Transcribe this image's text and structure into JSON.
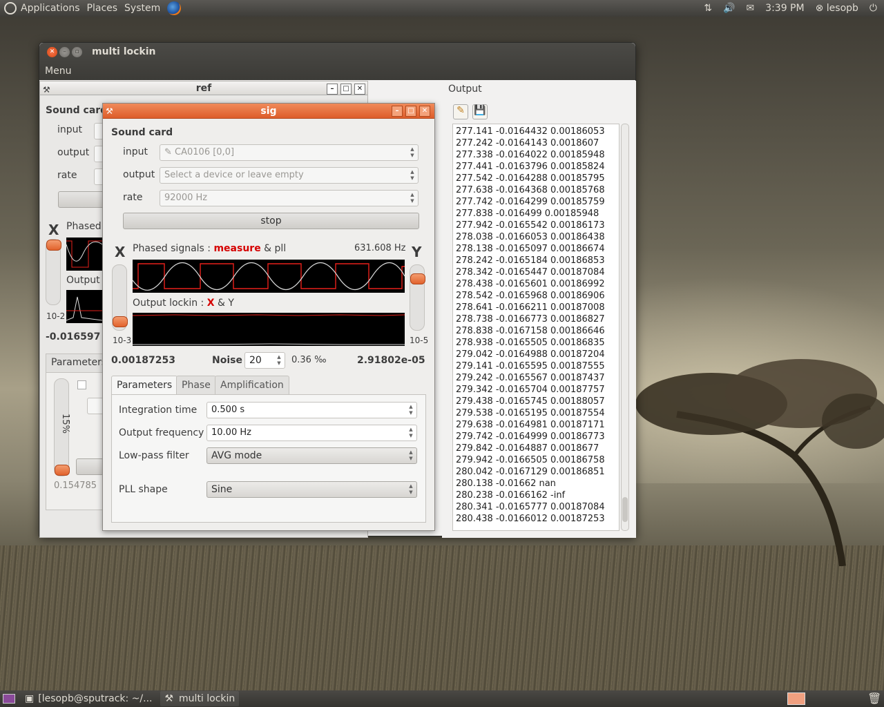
{
  "top_panel": {
    "menus": [
      "Applications",
      "Places",
      "System"
    ],
    "clock": "3:39 PM",
    "user": "lesopb"
  },
  "window": {
    "title": "multi lockin",
    "menu_label": "Menu"
  },
  "ref": {
    "title": "ref",
    "sound_card_label": "Sound card",
    "input_label": "input",
    "output_label": "output",
    "rate_label": "rate",
    "phased_label": "Phased",
    "output_label2": "Output",
    "x_label": "X",
    "scale_exp": "10-2",
    "value": "-0.016597",
    "params_tab": "Parameters",
    "slider_pct": "15%",
    "bottom_value": "0.154785"
  },
  "sig": {
    "title": "sig",
    "sound_card_label": "Sound card",
    "input_label": "input",
    "input_value": "CA0106 [0,0]",
    "output_label": "output",
    "output_placeholder": "Select a device or leave empty",
    "rate_label": "rate",
    "rate_value": "92000 Hz",
    "stop_button": "stop",
    "x_label": "X",
    "y_label": "Y",
    "phased_prefix": "Phased signals : ",
    "phased_measure": "measure",
    "phased_amp": " & ",
    "phased_pll": "pll",
    "frequency": "631.608 Hz",
    "output_lockin_prefix": "Output lockin : ",
    "output_x": "X",
    "output_amp": " & ",
    "output_y": "Y",
    "x_scale": "10-3",
    "y_scale": "10-5",
    "x_value": "0.00187253",
    "noise_label": "Noise",
    "noise_value": "20",
    "noise_pct": "0.36 ‰",
    "y_value": "2.91802e-05",
    "tabs": [
      "Parameters",
      "Phase",
      "Amplification"
    ],
    "params": {
      "integration_label": "Integration time",
      "integration_value": "0.500 s",
      "freq_label": "Output frequency",
      "freq_value": "10.00 Hz",
      "lowpass_label": "Low-pass filter",
      "lowpass_value": "AVG mode",
      "pll_label": "PLL shape",
      "pll_value": "Sine"
    },
    "x_slider_level": 0.05,
    "y_slider_level": 0.85
  },
  "output": {
    "title": "Output",
    "lines": [
      "277.141 -0.0164432 0.00186053",
      "277.242 -0.0164143 0.0018607",
      "277.338 -0.0164022 0.00185948",
      "277.441 -0.0163796 0.00185824",
      "277.542 -0.0164288 0.00185795",
      "277.638 -0.0164368 0.00185768",
      "277.742 -0.0164299 0.00185759",
      "277.838 -0.016499 0.00185948",
      "277.942 -0.0165542 0.00186173",
      "278.038 -0.0166053 0.00186438",
      "278.138 -0.0165097 0.00186674",
      "278.242 -0.0165184 0.00186853",
      "278.342 -0.0165447 0.00187084",
      "278.438 -0.0165601 0.00186992",
      "278.542 -0.0165968 0.00186906",
      "278.641 -0.0166211 0.00187008",
      "278.738 -0.0166773 0.00186827",
      "278.838 -0.0167158 0.00186646",
      "278.938 -0.0165505 0.00186835",
      "279.042 -0.0164988 0.00187204",
      "279.141 -0.0165595 0.00187555",
      "279.242 -0.0165567 0.00187437",
      "279.342 -0.0165704 0.00187757",
      "279.438 -0.0165745 0.00188057",
      "279.538 -0.0165195 0.00187554",
      "279.638 -0.0164981 0.00187171",
      "279.742 -0.0164999 0.00186773",
      "279.842 -0.0164887 0.0018677",
      "279.942 -0.0166505 0.00186758",
      "280.042 -0.0167129 0.00186851",
      "280.138 -0.01662 nan",
      "280.238 -0.0166162 -inf",
      "280.341 -0.0165777 0.00187084",
      "280.438 -0.0166012 0.00187253"
    ]
  },
  "taskbar": {
    "items": [
      "[lesopb@sputrack: ~/...",
      "multi lockin"
    ]
  },
  "colors": {
    "accent": "#e2632d",
    "measure_red": "#d50000",
    "trace_red": "#e8201a"
  }
}
